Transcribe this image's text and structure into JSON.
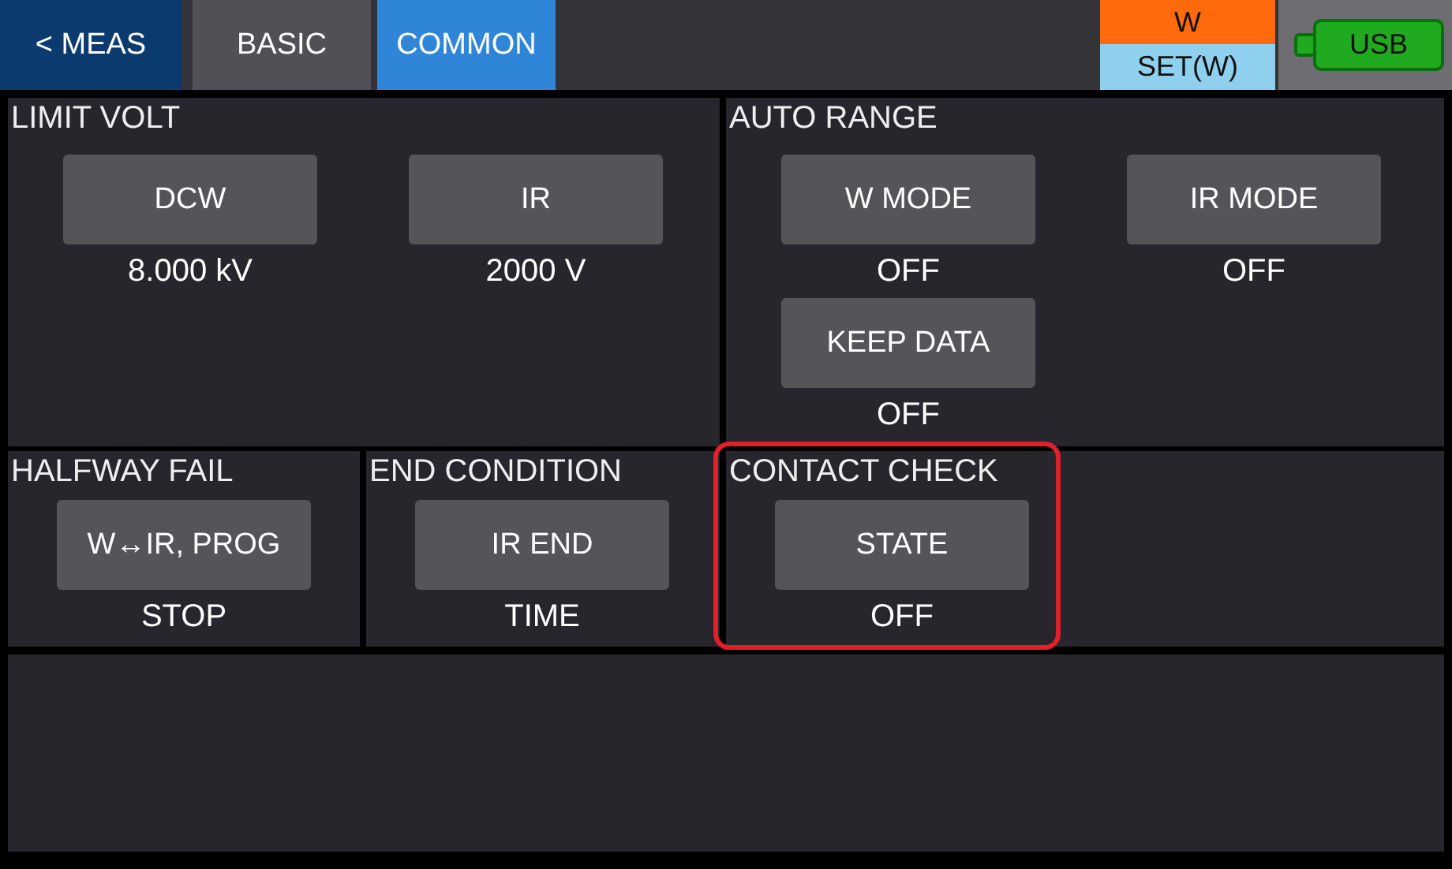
{
  "tabs": [
    {
      "label": "< MEAS",
      "kind": "back",
      "selected": false
    },
    {
      "label": "BASIC",
      "kind": "tab",
      "selected": false
    },
    {
      "label": "COMMON",
      "kind": "tab",
      "selected": true
    }
  ],
  "status": {
    "mode": "W",
    "setting": "SET(W)",
    "usb": "USB"
  },
  "sections": [
    {
      "title": "LIMIT VOLT",
      "highlighted": false,
      "items": [
        {
          "label": "DCW",
          "value": "8.000 kV"
        },
        {
          "label": "IR",
          "value": "2000 V"
        }
      ]
    },
    {
      "title": "AUTO RANGE",
      "highlighted": false,
      "items": [
        {
          "label": "W MODE",
          "value": "OFF"
        },
        {
          "label": "IR MODE",
          "value": "OFF"
        },
        {
          "label": "KEEP DATA",
          "value": "OFF"
        }
      ]
    },
    {
      "title": "HALFWAY FAIL",
      "highlighted": false,
      "items": [
        {
          "label": "W↔IR, PROG",
          "value": "STOP"
        }
      ]
    },
    {
      "title": "END CONDITION",
      "highlighted": false,
      "items": [
        {
          "label": "IR END",
          "value": "TIME"
        }
      ]
    },
    {
      "title": "CONTACT CHECK",
      "highlighted": true,
      "items": [
        {
          "label": "STATE",
          "value": "OFF"
        }
      ]
    }
  ]
}
